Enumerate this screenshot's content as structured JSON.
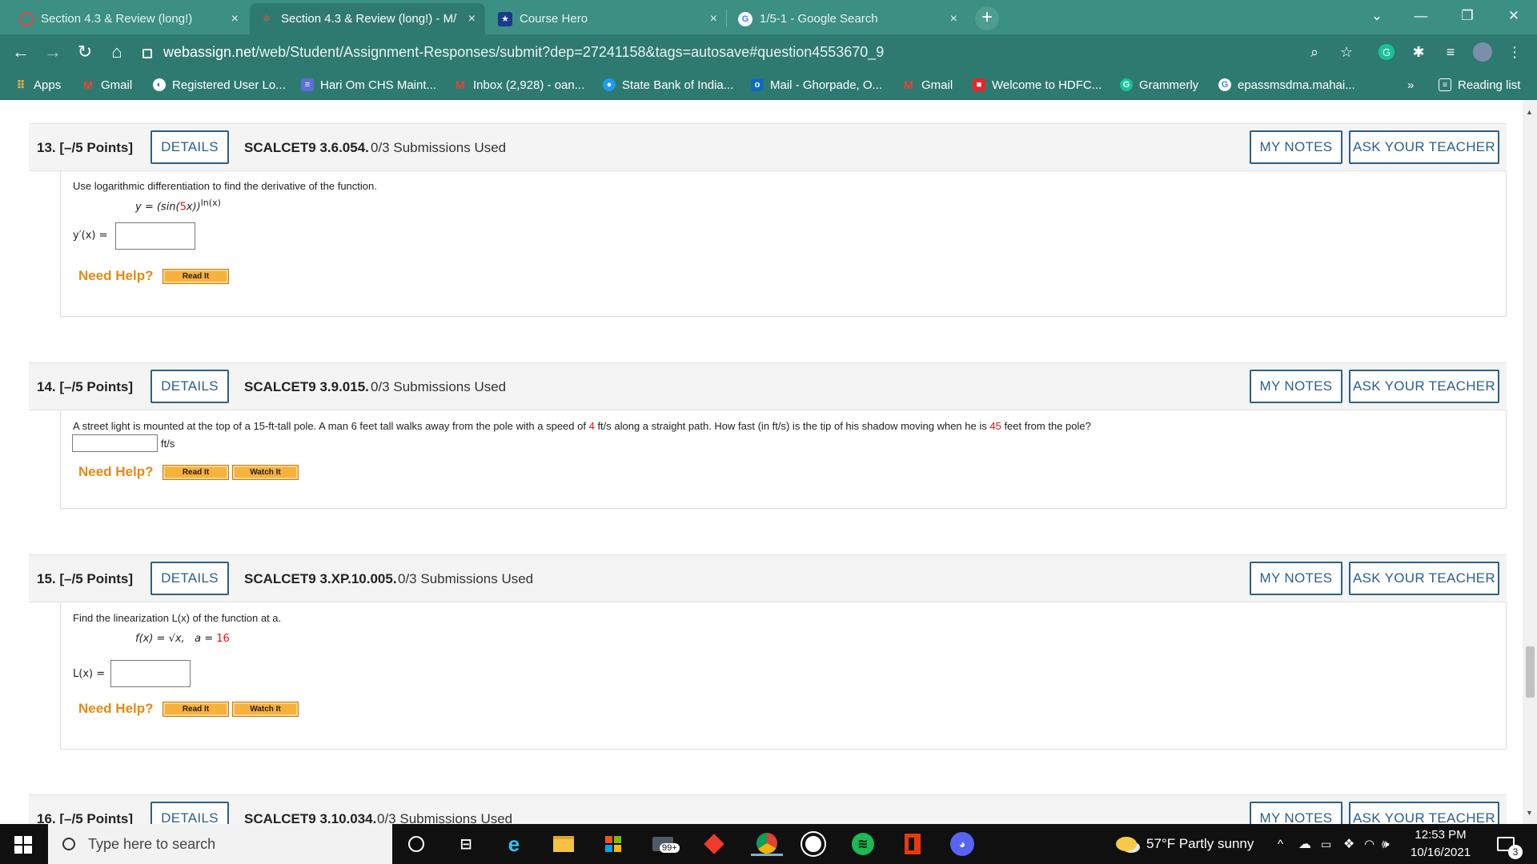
{
  "browser": {
    "tabs": [
      {
        "title": "Section 4.3 & Review (long!)",
        "close": "×",
        "fav_color": "#e6463a"
      },
      {
        "title": "Section 4.3 & Review (long!) - M/",
        "close": "×",
        "fav_color": "#d35b3a"
      },
      {
        "title": "Course Hero",
        "close": "×",
        "fav_color": "#1a3a8a"
      },
      {
        "title": "1/5-1 - Google Search",
        "close": "×",
        "fav_color": "#ffffff"
      }
    ],
    "new_tab": "+",
    "window_controls": {
      "dropdown": "⌄",
      "minimize": "—",
      "maximize": "❐",
      "close": "✕"
    },
    "url_host": "webassign.net",
    "url_path": "/web/Student/Assignment-Responses/submit?dep=27241158&tags=autosave#question4553670_9",
    "bookmarks": [
      {
        "label": "Apps",
        "icon": "apps-grid-icon"
      },
      {
        "label": "Gmail",
        "icon": "gmail-icon"
      },
      {
        "label": "Registered User Lo...",
        "icon": "globe-icon"
      },
      {
        "label": "Hari Om CHS Maint...",
        "icon": "list-icon"
      },
      {
        "label": "Inbox (2,928) - oan...",
        "icon": "gmail-icon"
      },
      {
        "label": "State Bank of India...",
        "icon": "sbi-icon"
      },
      {
        "label": "Mail - Ghorpade, O...",
        "icon": "outlook-icon"
      },
      {
        "label": "Gmail",
        "icon": "gmail-icon"
      },
      {
        "label": "Welcome to HDFC...",
        "icon": "hdfc-icon"
      },
      {
        "label": "Grammerly",
        "icon": "grammarly-icon"
      },
      {
        "label": "epassmsdma.mahai...",
        "icon": "google-icon"
      }
    ],
    "bookmarks_more": "»",
    "reading_list": "Reading list"
  },
  "questions": [
    {
      "number": "13.",
      "points": "[–/5 Points]",
      "details": "DETAILS",
      "code": "SCALCET9 3.6.054.",
      "submissions": "0/3 Submissions Used",
      "my_notes": "MY NOTES",
      "ask_teacher": "ASK YOUR TEACHER",
      "prompt": "Use logarithmic differentiation to find the derivative of the function.",
      "math": {
        "pre": "y = (sin(",
        "red": "5",
        "post": "x))",
        "sup": "ln(x)"
      },
      "answer_label": "y′(x)  =",
      "need_help": "Need Help?",
      "help_buttons": [
        "Read It"
      ]
    },
    {
      "number": "14.",
      "points": "[–/5 Points]",
      "details": "DETAILS",
      "code": "SCALCET9 3.9.015.",
      "submissions": "0/3 Submissions Used",
      "my_notes": "MY NOTES",
      "ask_teacher": "ASK YOUR TEACHER",
      "prompt_a": "A street light is mounted at the top of a 15-ft-tall pole. A man 6 feet tall walks away from the pole with a speed of ",
      "prompt_red1": "4",
      "prompt_b": " ft/s along a straight path. How fast (in ft/s) is the tip of his shadow moving when he is ",
      "prompt_red2": "45",
      "prompt_c": " feet from the pole?",
      "unit": "ft/s",
      "need_help": "Need Help?",
      "help_buttons": [
        "Read It",
        "Watch It"
      ]
    },
    {
      "number": "15.",
      "points": "[–/5 Points]",
      "details": "DETAILS",
      "code": "SCALCET9 3.XP.10.005.",
      "submissions": "0/3 Submissions Used",
      "my_notes": "MY NOTES",
      "ask_teacher": "ASK YOUR TEACHER",
      "prompt": "Find the linearization L(x) of the function at a.",
      "math": {
        "fx": "f(x) = √x,",
        "a_label": "a =",
        "a_value": "16"
      },
      "answer_label": "L(x)  =",
      "need_help": "Need Help?",
      "help_buttons": [
        "Read It",
        "Watch It"
      ]
    },
    {
      "number": "16.",
      "points": "[–/5 Points]",
      "details": "DETAILS",
      "code": "SCALCET9 3.10.034.",
      "submissions": "0/3 Submissions Used",
      "my_notes": "MY NOTES",
      "ask_teacher": "ASK YOUR TEACHER"
    }
  ],
  "taskbar": {
    "search_placeholder": "Type here to search",
    "mail_badge": "99+",
    "weather": "57°F  Partly sunny",
    "time": "12:53 PM",
    "date": "10/16/2021",
    "notifications": "3"
  }
}
